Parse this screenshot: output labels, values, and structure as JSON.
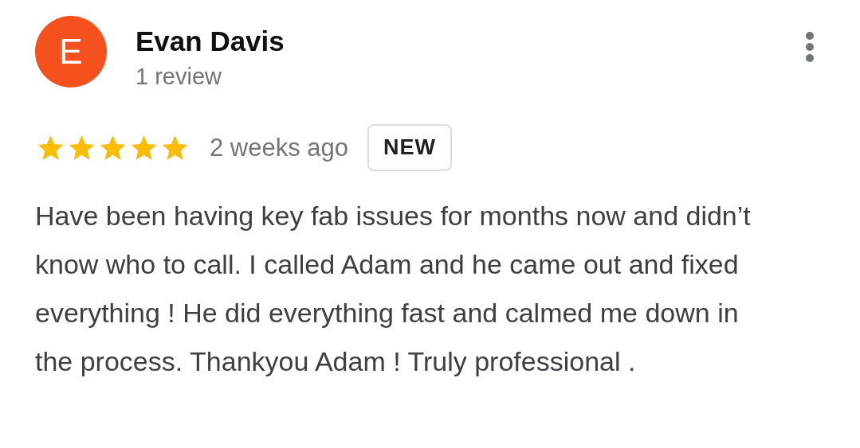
{
  "review": {
    "avatar_letter": "E",
    "name": "Evan Davis",
    "review_count": "1 review",
    "stars": 5,
    "time": "2 weeks ago",
    "badge": "NEW",
    "text": "Have been having key fab issues for months now and didn’t know who to call. I called Adam and he came out and fixed everything ! He did everything fast and calmed me down in the process. Thankyou Adam ! Truly professional ."
  }
}
